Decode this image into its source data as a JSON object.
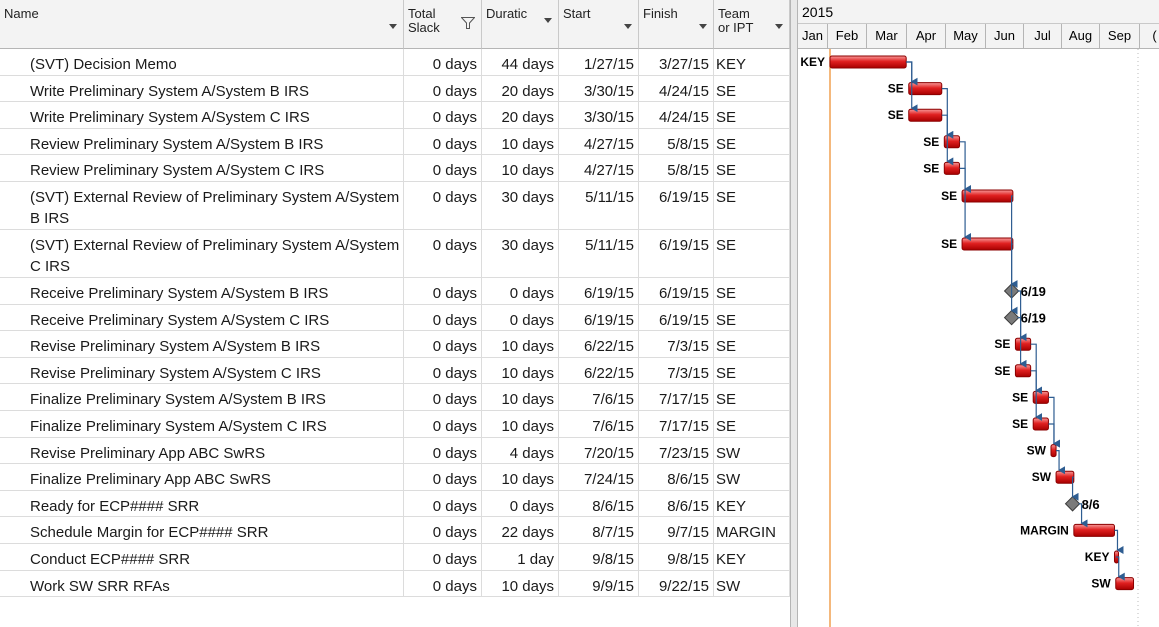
{
  "columns": {
    "name": "Name",
    "slack": "Total Slack",
    "duration": "Duratic",
    "start": "Start",
    "finish": "Finish",
    "team": "Team or IPT"
  },
  "gantt": {
    "year": "2015",
    "months": [
      "Jan",
      "Feb",
      "Mar",
      "Apr",
      "May",
      "Jun",
      "Jul",
      "Aug",
      "Sep",
      "("
    ]
  },
  "tasks": [
    {
      "name": "(SVT) Decision Memo",
      "slack": "0 days",
      "duration": "44 days",
      "start": "1/27/15",
      "finish": "3/27/15",
      "team": "KEY",
      "bar_label": "KEY"
    },
    {
      "name": "Write Preliminary System A/System B IRS",
      "slack": "0 days",
      "duration": "20 days",
      "start": "3/30/15",
      "finish": "4/24/15",
      "team": "SE",
      "bar_label": "SE"
    },
    {
      "name": "Write Preliminary System A/System C IRS",
      "slack": "0 days",
      "duration": "20 days",
      "start": "3/30/15",
      "finish": "4/24/15",
      "team": "SE",
      "bar_label": "SE"
    },
    {
      "name": "Review Preliminary System A/System B IRS",
      "slack": "0 days",
      "duration": "10 days",
      "start": "4/27/15",
      "finish": "5/8/15",
      "team": "SE",
      "bar_label": "SE"
    },
    {
      "name": "Review Preliminary System A/System C IRS",
      "slack": "0 days",
      "duration": "10 days",
      "start": "4/27/15",
      "finish": "5/8/15",
      "team": "SE",
      "bar_label": "SE"
    },
    {
      "name": "(SVT) External Review of Preliminary System A/System B IRS",
      "slack": "0 days",
      "duration": "30 days",
      "start": "5/11/15",
      "finish": "6/19/15",
      "team": "SE",
      "bar_label": "SE"
    },
    {
      "name": "(SVT) External Review of Preliminary System A/System C IRS",
      "slack": "0 days",
      "duration": "30 days",
      "start": "5/11/15",
      "finish": "6/19/15",
      "team": "SE",
      "bar_label": "SE"
    },
    {
      "name": "Receive Preliminary System A/System B IRS",
      "slack": "0 days",
      "duration": "0 days",
      "start": "6/19/15",
      "finish": "6/19/15",
      "team": "SE",
      "bar_label": "6/19"
    },
    {
      "name": "Receive Preliminary System A/System C IRS",
      "slack": "0 days",
      "duration": "0 days",
      "start": "6/19/15",
      "finish": "6/19/15",
      "team": "SE",
      "bar_label": "6/19"
    },
    {
      "name": "Revise Preliminary System A/System B IRS",
      "slack": "0 days",
      "duration": "10 days",
      "start": "6/22/15",
      "finish": "7/3/15",
      "team": "SE",
      "bar_label": "SE"
    },
    {
      "name": "Revise Preliminary System A/System C IRS",
      "slack": "0 days",
      "duration": "10 days",
      "start": "6/22/15",
      "finish": "7/3/15",
      "team": "SE",
      "bar_label": "SE"
    },
    {
      "name": "Finalize Preliminary System A/System B IRS",
      "slack": "0 days",
      "duration": "10 days",
      "start": "7/6/15",
      "finish": "7/17/15",
      "team": "SE",
      "bar_label": "SE"
    },
    {
      "name": "Finalize Preliminary System A/System C IRS",
      "slack": "0 days",
      "duration": "10 days",
      "start": "7/6/15",
      "finish": "7/17/15",
      "team": "SE",
      "bar_label": "SE"
    },
    {
      "name": "Revise Preliminary App ABC SwRS",
      "slack": "0 days",
      "duration": "4 days",
      "start": "7/20/15",
      "finish": "7/23/15",
      "team": "SW",
      "bar_label": "SW"
    },
    {
      "name": "Finalize Preliminary App ABC SwRS",
      "slack": "0 days",
      "duration": "10 days",
      "start": "7/24/15",
      "finish": "8/6/15",
      "team": "SW",
      "bar_label": "SW"
    },
    {
      "name": "Ready for ECP#### SRR",
      "slack": "0 days",
      "duration": "0 days",
      "start": "8/6/15",
      "finish": "8/6/15",
      "team": "KEY",
      "bar_label": "8/6"
    },
    {
      "name": " Schedule Margin for ECP#### SRR",
      "slack": "0 days",
      "duration": "22 days",
      "start": "8/7/15",
      "finish": "9/7/15",
      "team": "MARGIN",
      "bar_label": "MARGIN"
    },
    {
      "name": "Conduct ECP#### SRR",
      "slack": "0 days",
      "duration": "1 day",
      "start": "9/8/15",
      "finish": "9/8/15",
      "team": "KEY",
      "bar_label": "KEY"
    },
    {
      "name": "Work SW  SRR RFAs",
      "slack": "0 days",
      "duration": "10 days",
      "start": "9/9/15",
      "finish": "9/22/15",
      "team": "SW",
      "bar_label": "SW"
    }
  ]
}
